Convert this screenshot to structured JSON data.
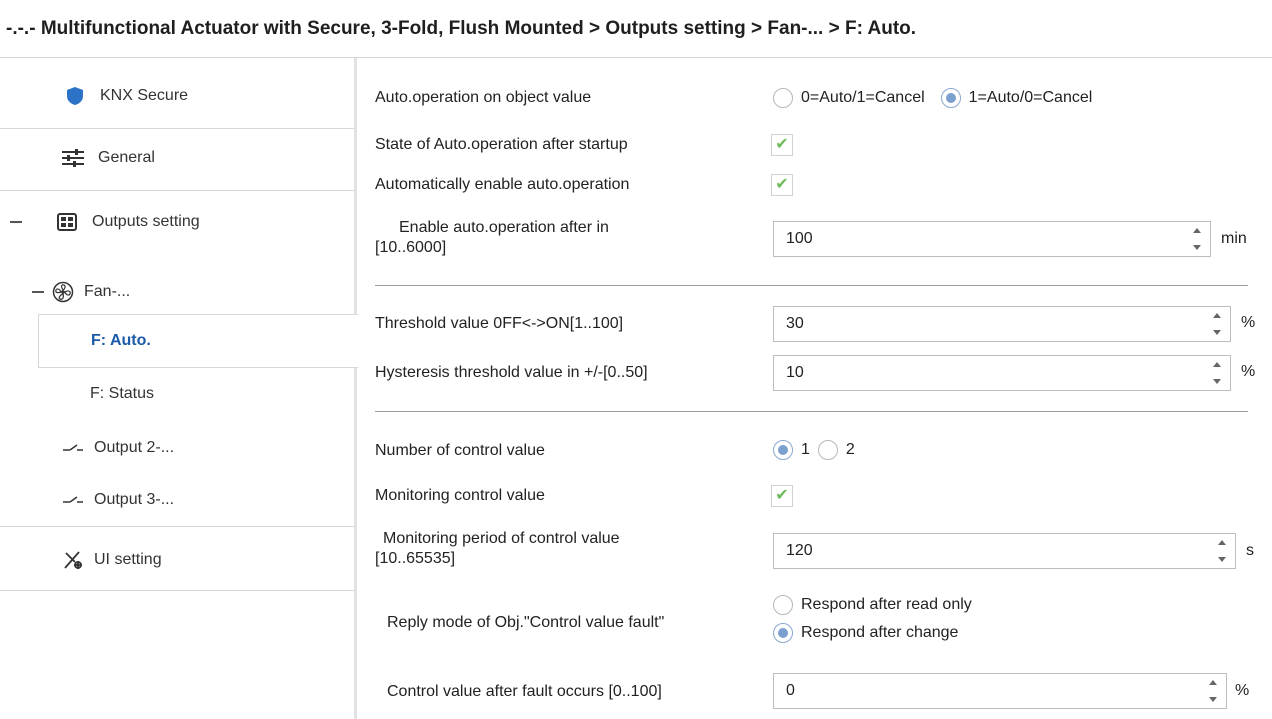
{
  "breadcrumb": "-.-.- Multifunctional Actuator with Secure, 3-Fold, Flush Mounted > Outputs setting > Fan-... > F: Auto.",
  "sidebar": {
    "items": [
      {
        "label": "KNX Secure",
        "icon": "shield-icon"
      },
      {
        "label": "General",
        "icon": "sliders-icon"
      },
      {
        "label": "Outputs setting",
        "icon": "grid-icon"
      },
      {
        "label": "Fan-...",
        "icon": "fan-icon"
      },
      {
        "label": "F: Auto.",
        "icon": ""
      },
      {
        "label": "F: Status",
        "icon": ""
      },
      {
        "label": "Output 2-...",
        "icon": "switch-icon"
      },
      {
        "label": "Output 3-...",
        "icon": "switch-icon"
      },
      {
        "label": "UI setting",
        "icon": "tools-icon"
      }
    ],
    "colors": {
      "accent": "#1b5aa8",
      "shield": "#2c73c8"
    }
  },
  "form": {
    "auto_op": {
      "label": "Auto.operation on object value",
      "options": [
        "0=Auto/1=Cancel",
        "1=Auto/0=Cancel"
      ],
      "selected": 1
    },
    "state_after_startup": {
      "label": "State of Auto.operation after startup",
      "checked": true
    },
    "auto_enable": {
      "label": "Automatically enable auto.operation",
      "checked": true
    },
    "enable_after": {
      "label_1": "Enable auto.operation after in",
      "label_2": "[10..6000]",
      "value": "100",
      "unit": "min"
    },
    "threshold": {
      "label": "Threshold value 0FF<->ON[1..100]",
      "value": "30",
      "unit": "%"
    },
    "hysteresis": {
      "label": "Hysteresis threshold value in +/-[0..50]",
      "value": "10",
      "unit": "%"
    },
    "num_control": {
      "label": "Number of control value",
      "options": [
        "1",
        "2"
      ],
      "selected": 0
    },
    "monitoring": {
      "label": "Monitoring control value",
      "checked": true
    },
    "monitor_period": {
      "label_1": "Monitoring period of control value",
      "label_2": "[10..65535]",
      "value": "120",
      "unit": "s"
    },
    "reply_mode": {
      "label": "Reply mode of Obj.\"Control value fault\"",
      "options": [
        "Respond after read only",
        "Respond after change"
      ],
      "selected": 1
    },
    "after_fault": {
      "label": "Control value after fault occurs [0..100]",
      "value": "0",
      "unit": "%"
    }
  }
}
